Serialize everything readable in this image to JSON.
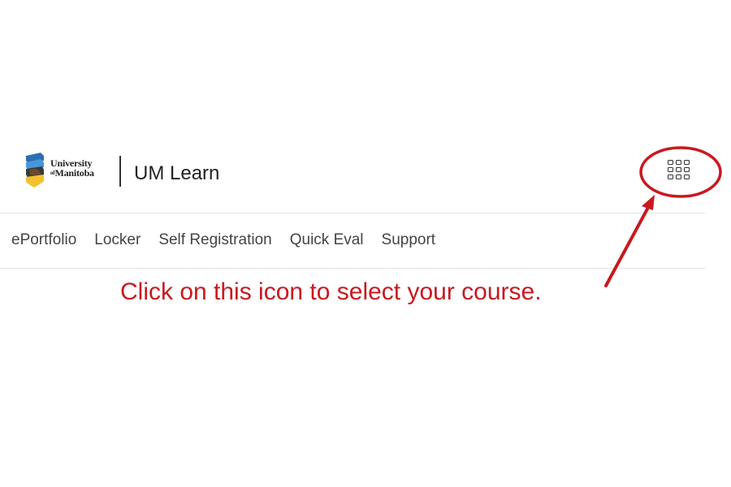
{
  "logo": {
    "line1": "University",
    "line2_prefix": "of",
    "line2": "Manitoba",
    "icon": "university-crest-icon"
  },
  "header": {
    "app_title": "UM Learn",
    "course_selector_icon": "app-grid-icon"
  },
  "nav": {
    "items": [
      {
        "label": "ePortfolio"
      },
      {
        "label": "Locker"
      },
      {
        "label": "Self Registration"
      },
      {
        "label": "Quick Eval"
      },
      {
        "label": "Support"
      }
    ]
  },
  "annotation": {
    "text": "Click on this icon to select your course.",
    "color": "#c8191f"
  }
}
